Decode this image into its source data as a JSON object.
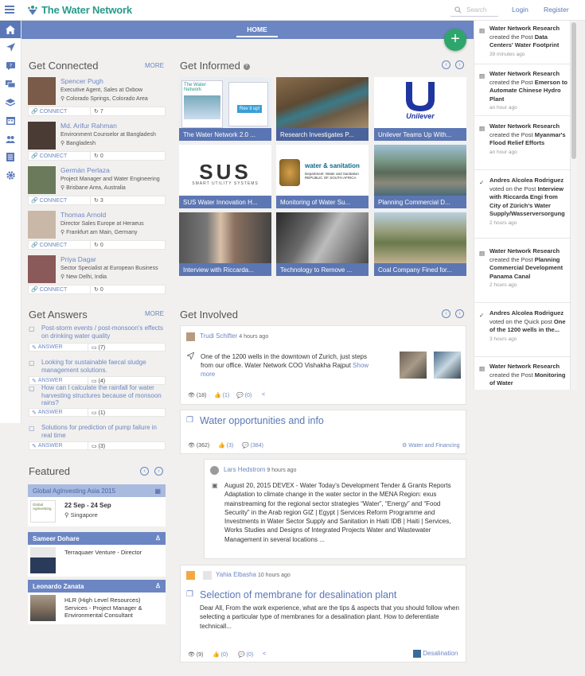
{
  "header": {
    "logo_text": "The Water Network",
    "search_placeholder": "Search",
    "login": "Login",
    "register": "Register"
  },
  "nav": {
    "home_tab": "HOME"
  },
  "fab_label": "+",
  "get_connected": {
    "title": "Get Connected",
    "more": "MORE",
    "connect_label": "CONNECT",
    "people": [
      {
        "name": "Spencer Pugh",
        "title": "Executive Agent, Sales at Oxbow",
        "location": "Colorado Springs, Colorado Area",
        "count": "7"
      },
      {
        "name": "Md. Arifur Rahman",
        "title": "Environment Counselor at Bangladesh",
        "location": "Bangladesh",
        "count": "0"
      },
      {
        "name": "Germán Perlaza",
        "title": "Project Manager and Water Engineering",
        "location": "Brisbane Area, Australia",
        "count": "3"
      },
      {
        "name": "Thomas Arnold",
        "title": "Director Sales Europe at Heraeus",
        "location": "Frankfurt am Main, Germany",
        "count": "0"
      },
      {
        "name": "Priya Dagar",
        "title": "Sector Specialist at European Business",
        "location": "New Delhi, India",
        "count": "0"
      }
    ]
  },
  "get_informed": {
    "title": "Get Informed",
    "tiles": [
      "The Water Network 2.0 ...",
      "Research Investigates P...",
      "Unilever Teams Up With...",
      "SUS Water Innovation H...",
      "Monitoring of Water Su...",
      "Planning Commercial D...",
      "Interview with Riccarda...",
      "Technology to Remove ...",
      "Coal Company Fined for..."
    ],
    "tile_logo_texts": {
      "sus": "SUS",
      "sus_sub": "SMART   UTILITY   SYSTEMS",
      "ws": "water & sanitation",
      "ws_sub": "Department: Water and Sanitation REPUBLIC OF SOUTH AFRICA",
      "unilever": "Unilever",
      "twn": "The Water Network",
      "revit": "Rev it up!"
    }
  },
  "get_answers": {
    "title": "Get Answers",
    "more": "MORE",
    "answer_label": "ANSWER",
    "questions": [
      {
        "text": "Post-storm events / post-monsoon's effects on drinking water quality",
        "count": "7"
      },
      {
        "text": "Looking for sustainable faecal sludge management solutions.",
        "count": "4"
      },
      {
        "text": "How can I calculate the rainfall for water harvesting structures because of monsoon rains?",
        "count": "1"
      },
      {
        "text": "Solutions for prediction of pump failure in real time",
        "count": "3"
      }
    ]
  },
  "featured": {
    "title": "Featured",
    "event": {
      "name": "Global AgInvesting Asia 2015",
      "dates": "22 Sep - 24 Sep",
      "location": "Singapore",
      "logo_text": "Global AgInvesting"
    },
    "people": [
      {
        "name": "Sameer Dohare",
        "role": "Terraquaer Venture - Director"
      },
      {
        "name": "Leonardo Zanata",
        "role": "HLR (High Level Resources) Services - Project Manager & Environmental Consultant"
      }
    ]
  },
  "get_involved": {
    "title": "Get Involved",
    "post1": {
      "author": "Trudi Schifter",
      "time": "4 hours ago",
      "text": "One of the 1200 wells in the downtown of Zurich, just steps from our office. Water Network COO Vishakha Rajput",
      "show_more": "Show more",
      "views": "(18)",
      "likes": "(1)",
      "comments": "(0)"
    },
    "post2": {
      "title": "Water opportunities and info",
      "views": "(362)",
      "likes": "(3)",
      "comments": "(384)",
      "tag": "Water and Financing"
    },
    "post2_reply": {
      "author": "Lars Hedstrom",
      "time": "9 hours ago",
      "text": "August 20, 2015 DEVEX - Water Today's Development Tender & Grants Reports Adaptation to climate change in the water sector in the MENA Region: exus mainstreaming for the regional sector strategies “Water”, “Energy” and “Food Security” in the Arab region GIZ | Egypt | Services Reform Programme and Investments in Water Sector Supply and Sanitation in Haiti IDB | Haiti | Services, Works Studies and Designs of Integrated Projects Water and Wastewater Management in several locations ..."
    },
    "post3": {
      "author": "Yahia Elbasha",
      "time": "10 hours ago",
      "title": "Selection of membrane for desalination plant",
      "text": "Dear All, From the work experience, what are the tips & aspects that you should follow when selecting a particular type of membranes for a desalination plant. How to deferentiate technicall...",
      "views": "(9)",
      "likes": "(0)",
      "comments": "(0)",
      "tag": "Desalination"
    }
  },
  "feed": {
    "items": [
      {
        "actor": "Water Network Research",
        "action": "created the Post",
        "target": "Data Centers' Water Footprint",
        "time": "39 minutes ago"
      },
      {
        "actor": "Water Network Research",
        "action": "created the Post",
        "target": "Emerson to Automate Chinese Hydro Plant",
        "time": "an hour ago"
      },
      {
        "actor": "Water Network Research",
        "action": "created the Post",
        "target": "Myanmar's Flood Relief Efforts",
        "time": "an hour ago"
      },
      {
        "actor": "Andres Alcolea Rodriguez",
        "action": "voted on the Post",
        "target": "Interview with Riccarda Engi from City of Zürich's Water Supply/Wasserversorgung",
        "time": "2 hours ago"
      },
      {
        "actor": "Water Network Research",
        "action": "created the Post",
        "target": "Planning Commercial Development Panama Canal",
        "time": "2 hours ago"
      },
      {
        "actor": "Andres Alcolea Rodriguez",
        "action": "voted on the Quick post",
        "target": "One of the 1200 wells in the...",
        "time": "3 hours ago"
      },
      {
        "actor": "Water Network Research",
        "action": "created the Post",
        "target": "Monitoring of Water",
        "time": ""
      }
    ]
  },
  "colors": {
    "brand_blue": "#6c86c3",
    "brand_teal": "#2a9a8a",
    "fab_green": "#2ea66b"
  }
}
